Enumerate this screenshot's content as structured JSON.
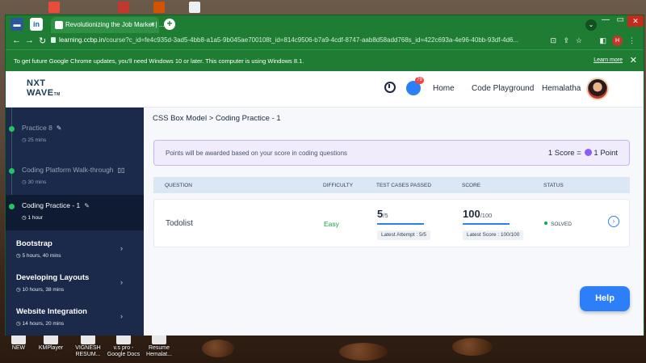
{
  "browser": {
    "tab_title": "Revolutionizing the Job Market | ...",
    "tab_close": "×",
    "new_tab": "+",
    "li_tab": "in",
    "url_host": "learning.ccbp.in",
    "url_path": "/course?c_id=fe4c935d-3ad5-4bb8-a1a5-9b045ae700108t_id=814c9506-b7a9-4cdf-8747-aab8d58add768s_id=422c693a-4e96-40bb-93df-4d6...",
    "profile_letter": "H",
    "update_notice": "To get future Google Chrome updates, you'll need Windows 10 or later. This computer is using Windows 8.1.",
    "learn_more": "Learn more",
    "notice_close": "✕"
  },
  "header": {
    "logo_line1": "NXT",
    "logo_line2": "WAVE",
    "logo_tm": "TM",
    "chat_badge": "79",
    "home": "Home",
    "code_playground": "Code Playground",
    "user_name": "Hemalatha"
  },
  "sidebar": {
    "items": [
      {
        "title": "Practice 8",
        "duration": "25 mins"
      },
      {
        "title": "Coding Platform Walk-through",
        "duration": "30 mins"
      },
      {
        "title": "Coding Practice - 1",
        "duration": "1 hour"
      }
    ],
    "modules": [
      {
        "title": "Bootstrap",
        "duration": "5 hours, 40 mins"
      },
      {
        "title": "Developing Layouts",
        "duration": "10 hours, 38 mins"
      },
      {
        "title": "Website Integration",
        "duration": "14 hours, 20 mins"
      }
    ]
  },
  "main": {
    "breadcrumb": "CSS Box Model > Coding Practice - 1",
    "points_note": "Points will be awarded based on your score in coding questions",
    "points_rule_left": "1 Score =",
    "points_rule_right": "1 Point",
    "columns": [
      "QUESTION",
      "DIFFICULTY",
      "TEST CASES PASSED",
      "SCORE",
      "STATUS"
    ],
    "row": {
      "question": "Todolist",
      "difficulty": "Easy",
      "passed": "5",
      "passed_total": "/5",
      "passed_fraction": 1.0,
      "latest_attempt": "Latest Attempt : 5/5",
      "score": "100",
      "score_total": "/100",
      "score_fraction": 1.0,
      "latest_score": "Latest Score : 100/100",
      "status": "SOLVED"
    },
    "help": "Help"
  },
  "desktop": {
    "icons": [
      {
        "label": "NEW"
      },
      {
        "label": "KMPlayer"
      },
      {
        "label": "VIGNESH RESUM..."
      },
      {
        "label": "v.s pro - Google Docs"
      },
      {
        "label": "Resume Hemalat..."
      }
    ]
  },
  "colors": {
    "chrome_green": "#1e7d33",
    "sidebar_bg": "#1b2a4a",
    "accent_blue": "#2d7ff9",
    "success_green": "#16a34a",
    "points_border": "#c4b5fd"
  }
}
